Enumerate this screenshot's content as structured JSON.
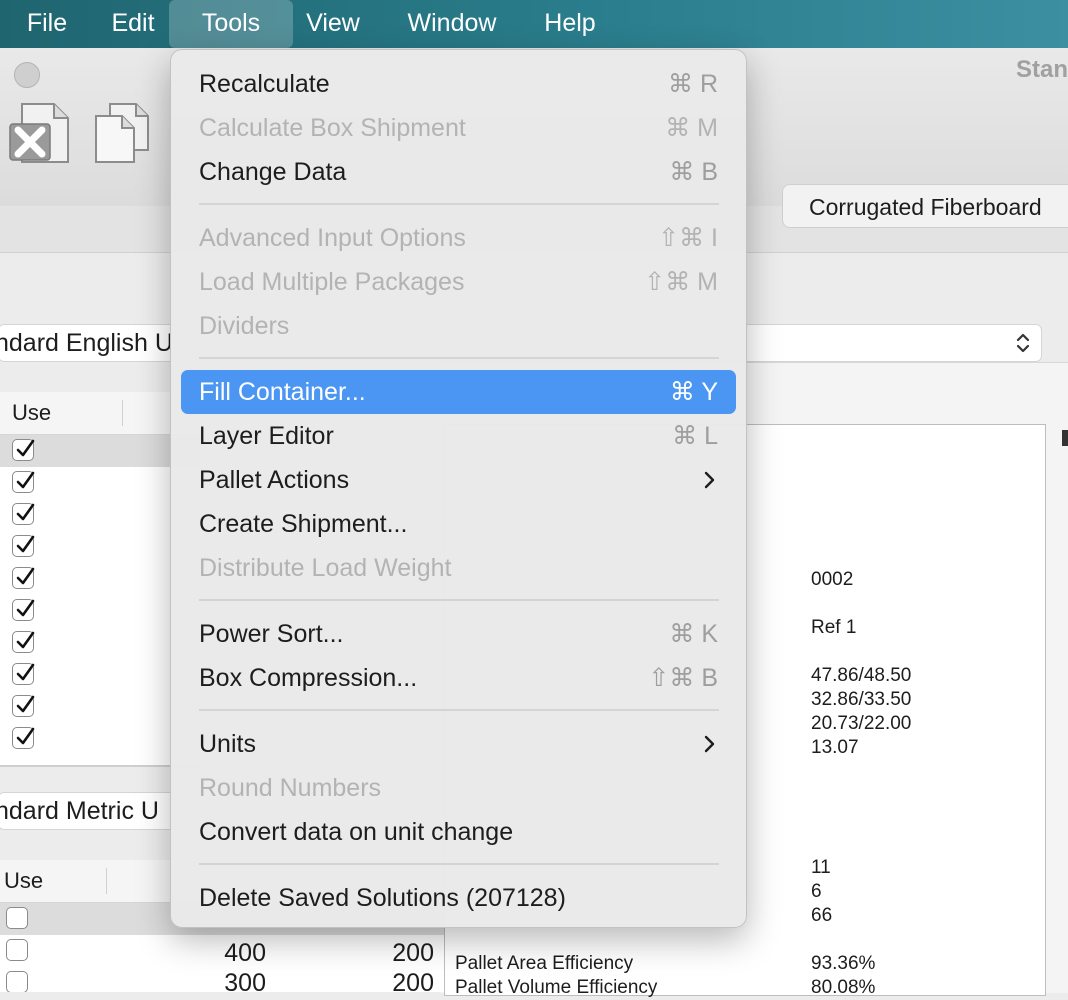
{
  "menubar": {
    "items": [
      "File",
      "Edit",
      "Tools",
      "View",
      "Window",
      "Help"
    ],
    "active": "Tools"
  },
  "window": {
    "title": "Stan"
  },
  "toolbar": {
    "segment_label": "Corrugated Fiberboard"
  },
  "selectors": {
    "english": "ndard English U",
    "metric": "ndard Metric U"
  },
  "tables": {
    "top": {
      "header": "Use",
      "rows": [
        true,
        true,
        true,
        true,
        true,
        true,
        true,
        true,
        true,
        true
      ]
    },
    "bottom": {
      "header": "Use",
      "rows": [
        false,
        false,
        false
      ],
      "numbers": [
        [
          "400",
          "200"
        ],
        [
          "300",
          "200"
        ]
      ]
    }
  },
  "results": {
    "values_a": [
      "0002",
      "Ref 1"
    ],
    "values_b": [
      "47.86/48.50",
      "32.86/33.50",
      "20.73/22.00",
      "13.07"
    ],
    "values_c": [
      "11",
      "6",
      "66"
    ],
    "efficiency": [
      {
        "label": "Pallet Area Efficiency",
        "value": "93.36%"
      },
      {
        "label": "Pallet Volume Efficiency",
        "value": "80.08%"
      }
    ]
  },
  "tools_menu": {
    "groups": [
      [
        {
          "label": "Recalculate",
          "shortcut": "⌘ R",
          "enabled": true
        },
        {
          "label": "Calculate Box Shipment",
          "shortcut": "⌘ M",
          "enabled": false
        },
        {
          "label": "Change Data",
          "shortcut": "⌘ B",
          "enabled": true
        }
      ],
      [
        {
          "label": "Advanced Input Options",
          "shortcut": "⇧⌘ I",
          "enabled": false
        },
        {
          "label": "Load Multiple Packages",
          "shortcut": "⇧⌘ M",
          "enabled": false
        },
        {
          "label": "Dividers",
          "shortcut": "",
          "enabled": false
        }
      ],
      [
        {
          "label": "Fill Container...",
          "shortcut": "⌘ Y",
          "enabled": true,
          "highlighted": true
        },
        {
          "label": "Layer Editor",
          "shortcut": "⌘ L",
          "enabled": true
        },
        {
          "label": "Pallet Actions",
          "shortcut": "",
          "enabled": true,
          "submenu": true
        },
        {
          "label": "Create Shipment...",
          "shortcut": "",
          "enabled": true
        },
        {
          "label": "Distribute Load Weight",
          "shortcut": "",
          "enabled": false
        }
      ],
      [
        {
          "label": "Power Sort...",
          "shortcut": "⌘ K",
          "enabled": true
        },
        {
          "label": "Box Compression...",
          "shortcut": "⇧⌘ B",
          "enabled": true
        }
      ],
      [
        {
          "label": "Units",
          "shortcut": "",
          "enabled": true,
          "submenu": true
        },
        {
          "label": "Round Numbers",
          "shortcut": "",
          "enabled": false
        },
        {
          "label": "Convert data on unit change",
          "shortcut": "",
          "enabled": true
        }
      ],
      [
        {
          "label": "Delete Saved Solutions (207128)",
          "shortcut": "",
          "enabled": true
        }
      ]
    ]
  }
}
